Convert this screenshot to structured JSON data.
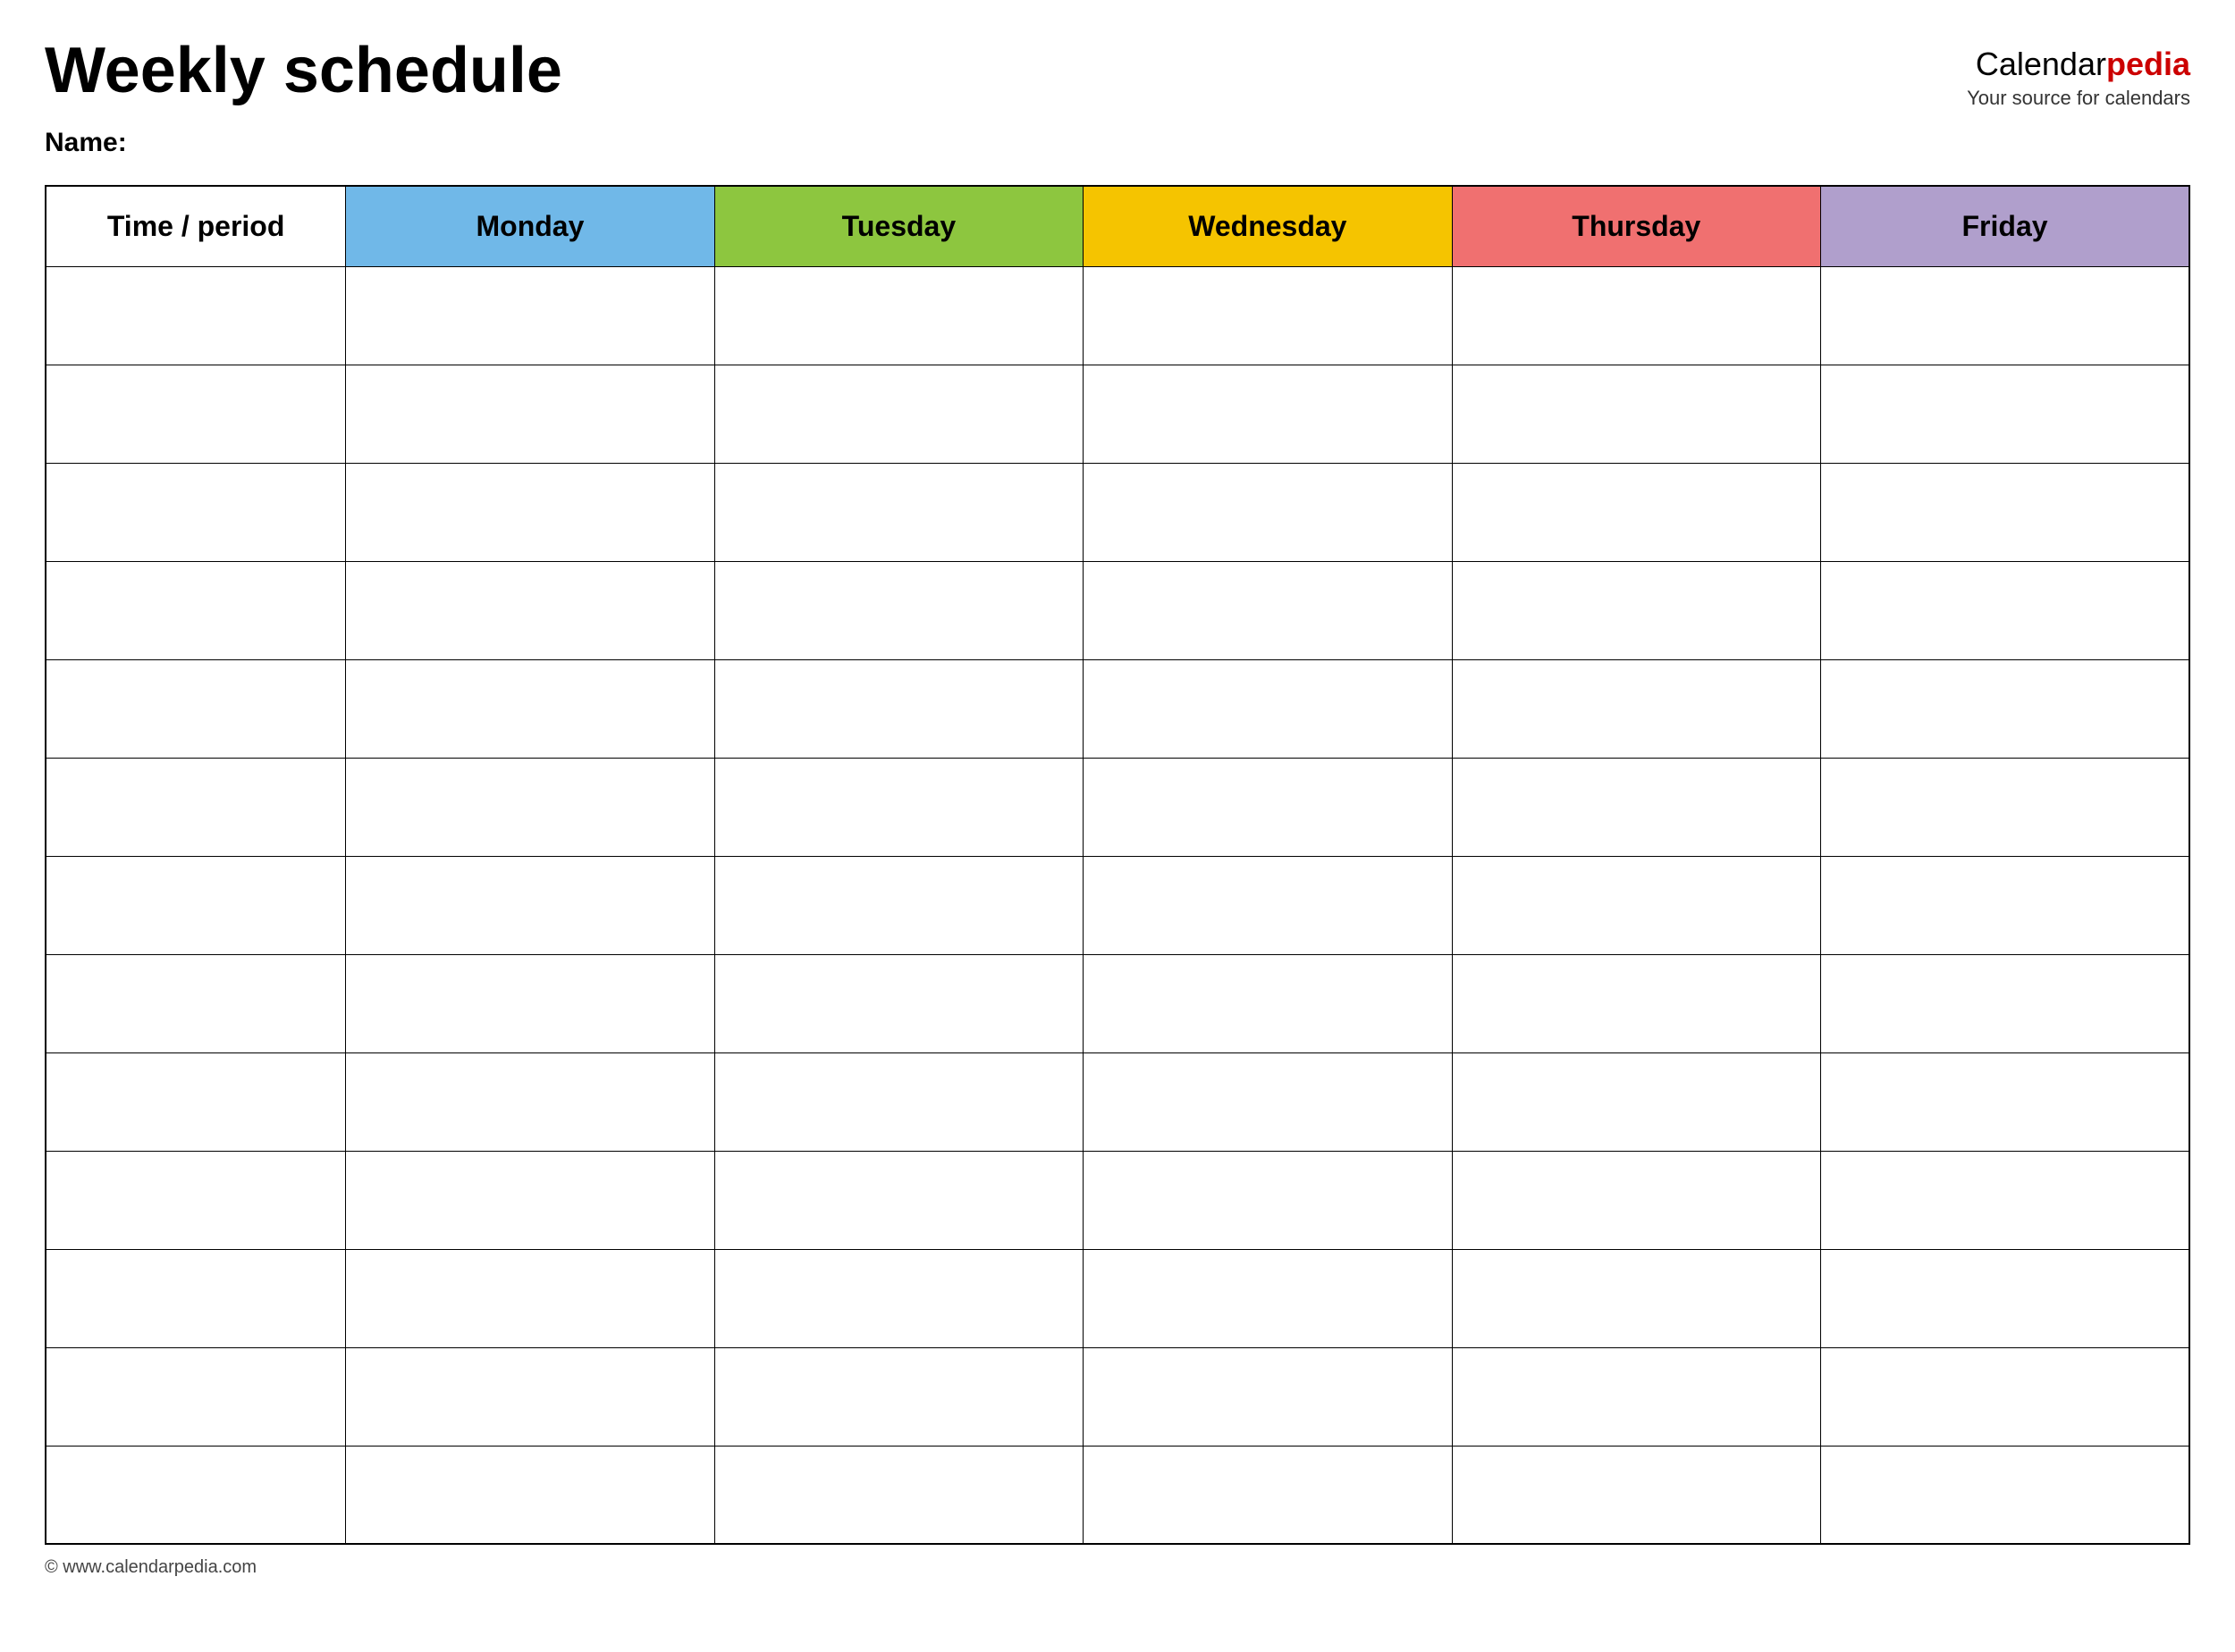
{
  "header": {
    "title": "Weekly schedule",
    "logo": {
      "calendar_part": "Calendar",
      "pedia_part": "pedia",
      "tagline": "Your source for calendars"
    }
  },
  "name_label": "Name:",
  "table": {
    "headers": [
      {
        "id": "time",
        "label": "Time / period",
        "color": "#ffffff"
      },
      {
        "id": "monday",
        "label": "Monday",
        "color": "#70b8e8"
      },
      {
        "id": "tuesday",
        "label": "Tuesday",
        "color": "#8dc63f"
      },
      {
        "id": "wednesday",
        "label": "Wednesday",
        "color": "#f5c400"
      },
      {
        "id": "thursday",
        "label": "Thursday",
        "color": "#f07070"
      },
      {
        "id": "friday",
        "label": "Friday",
        "color": "#b09fcc"
      }
    ],
    "row_count": 13
  },
  "footer": {
    "copyright": "© www.calendarpedia.com"
  }
}
